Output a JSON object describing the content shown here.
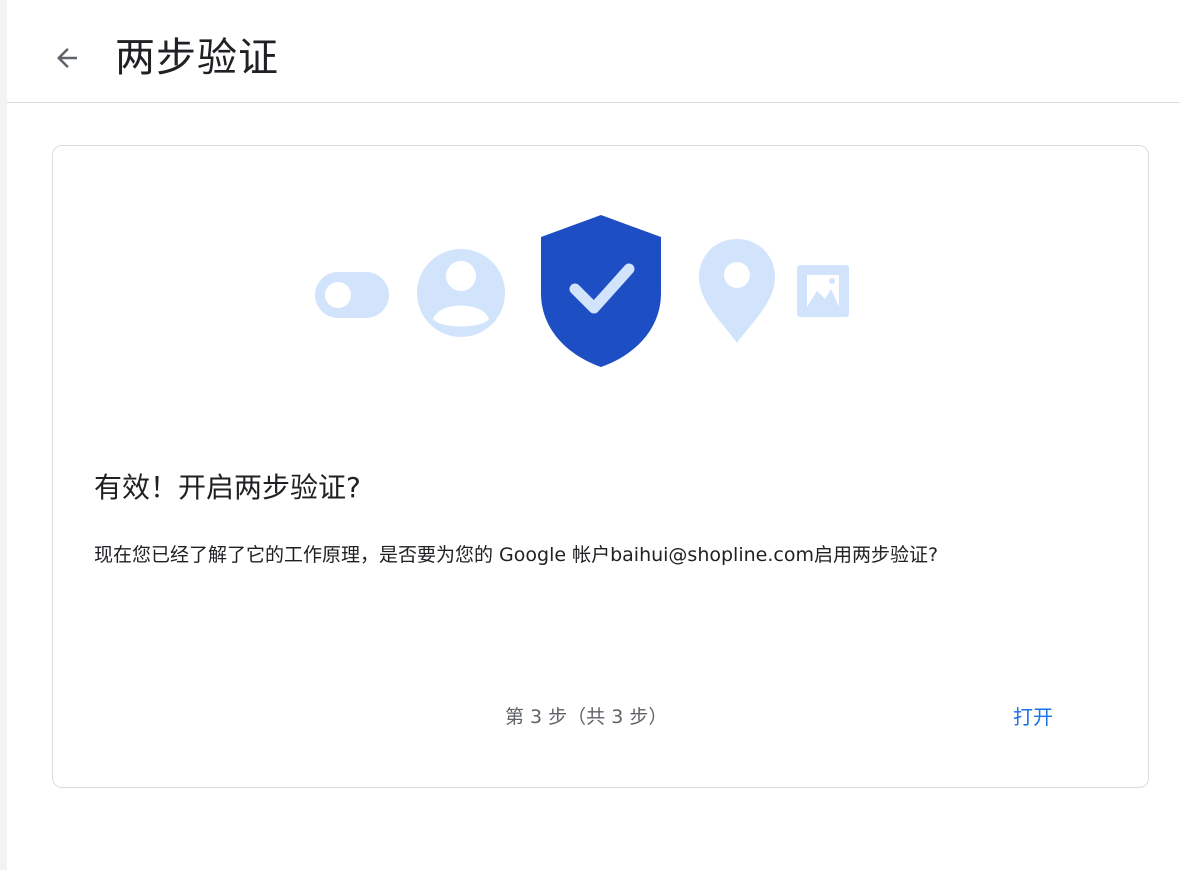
{
  "header": {
    "back_icon": "arrow-back-icon",
    "title": "两步验证"
  },
  "illustration": {
    "icons": [
      "toggle-icon",
      "account-circle-icon",
      "shield-check-icon",
      "location-pin-icon",
      "image-icon"
    ],
    "colors": {
      "light_blue": "#d2e3fc",
      "shield_blue": "#1e4ec3",
      "check": "#d2e3fc"
    }
  },
  "card": {
    "title": "有效！开启两步验证?",
    "description": "现在您已经了解了它的工作原理，是否要为您的 Google 帐户baihui@shopline.com启用两步验证?",
    "step_indicator": "第 3 步（共 3 步）",
    "turn_on_label": "打开"
  },
  "colors": {
    "accent": "#1a73e8",
    "border": "#dadce0"
  }
}
